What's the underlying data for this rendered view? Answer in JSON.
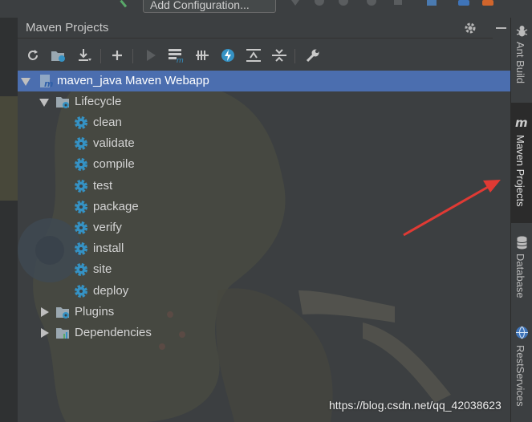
{
  "top_toolbar": {
    "config_label": "Add Configuration..."
  },
  "panel": {
    "title": "Maven Projects",
    "settings_icon": "gear-icon",
    "minimize_icon": "minimize-icon"
  },
  "toolbar_icons": [
    "reimport-icon",
    "generate-sources-icon",
    "download-icon",
    "add-project-icon",
    "run-icon",
    "execute-goal-icon",
    "toggle-offline-icon",
    "skip-tests-icon",
    "show-dependencies-icon",
    "collapse-all-icon",
    "settings-wrench-icon"
  ],
  "tree": {
    "root": {
      "label": "maven_java Maven Webapp",
      "icon": "maven-module-icon"
    },
    "lifecycle": {
      "label": "Lifecycle",
      "icon": "folder-gear-icon",
      "goals": [
        "clean",
        "validate",
        "compile",
        "test",
        "package",
        "verify",
        "install",
        "site",
        "deploy"
      ]
    },
    "plugins": {
      "label": "Plugins",
      "icon": "folder-gear-icon"
    },
    "dependencies": {
      "label": "Dependencies",
      "icon": "folder-chart-icon"
    }
  },
  "right_tabs": [
    {
      "label": "Ant Build",
      "icon": "ant-icon"
    },
    {
      "label": "Maven Projects",
      "icon": "maven-m-icon"
    },
    {
      "label": "Database",
      "icon": "database-icon"
    },
    {
      "label": "RestServices",
      "icon": "globe-icon"
    }
  ],
  "watermark": "https://blog.csdn.net/qq_42038623",
  "colors": {
    "selection": "#4b6eaf",
    "gear": "#3592c4",
    "annotation_arrow": "#e03a34"
  }
}
